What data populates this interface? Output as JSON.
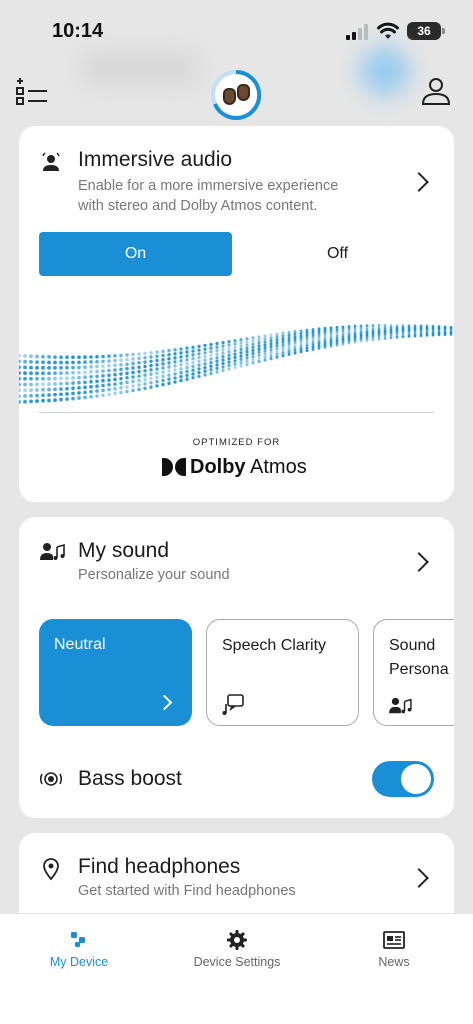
{
  "status_bar": {
    "time": "10:14",
    "battery": "36"
  },
  "immersive": {
    "title": "Immersive audio",
    "subtitle_line1": "Enable for a more immersive experience",
    "subtitle_line2": "with stereo and Dolby Atmos content.",
    "on_label": "On",
    "off_label": "Off",
    "selected": "On",
    "optimized_for": "OPTIMIZED FOR",
    "dolby_bold": "Dolby",
    "dolby_light": " Atmos"
  },
  "my_sound": {
    "title": "My sound",
    "subtitle": "Personalize your sound",
    "presets": [
      {
        "label": "Neutral"
      },
      {
        "label": "Speech Clarity"
      },
      {
        "label_line1": "Sound",
        "label_line2": "Persona"
      }
    ],
    "bass_boost_label": "Bass boost",
    "bass_boost_on": true
  },
  "find": {
    "title": "Find headphones",
    "subtitle": "Get started with Find headphones"
  },
  "tabs": [
    {
      "label": "My Device",
      "icon": "device-icon"
    },
    {
      "label": "Device Settings",
      "icon": "gear-icon"
    },
    {
      "label": "News",
      "icon": "news-icon"
    }
  ],
  "colors": {
    "accent": "#1b8fd6",
    "background": "#e6e6e6",
    "card": "#ffffff"
  }
}
